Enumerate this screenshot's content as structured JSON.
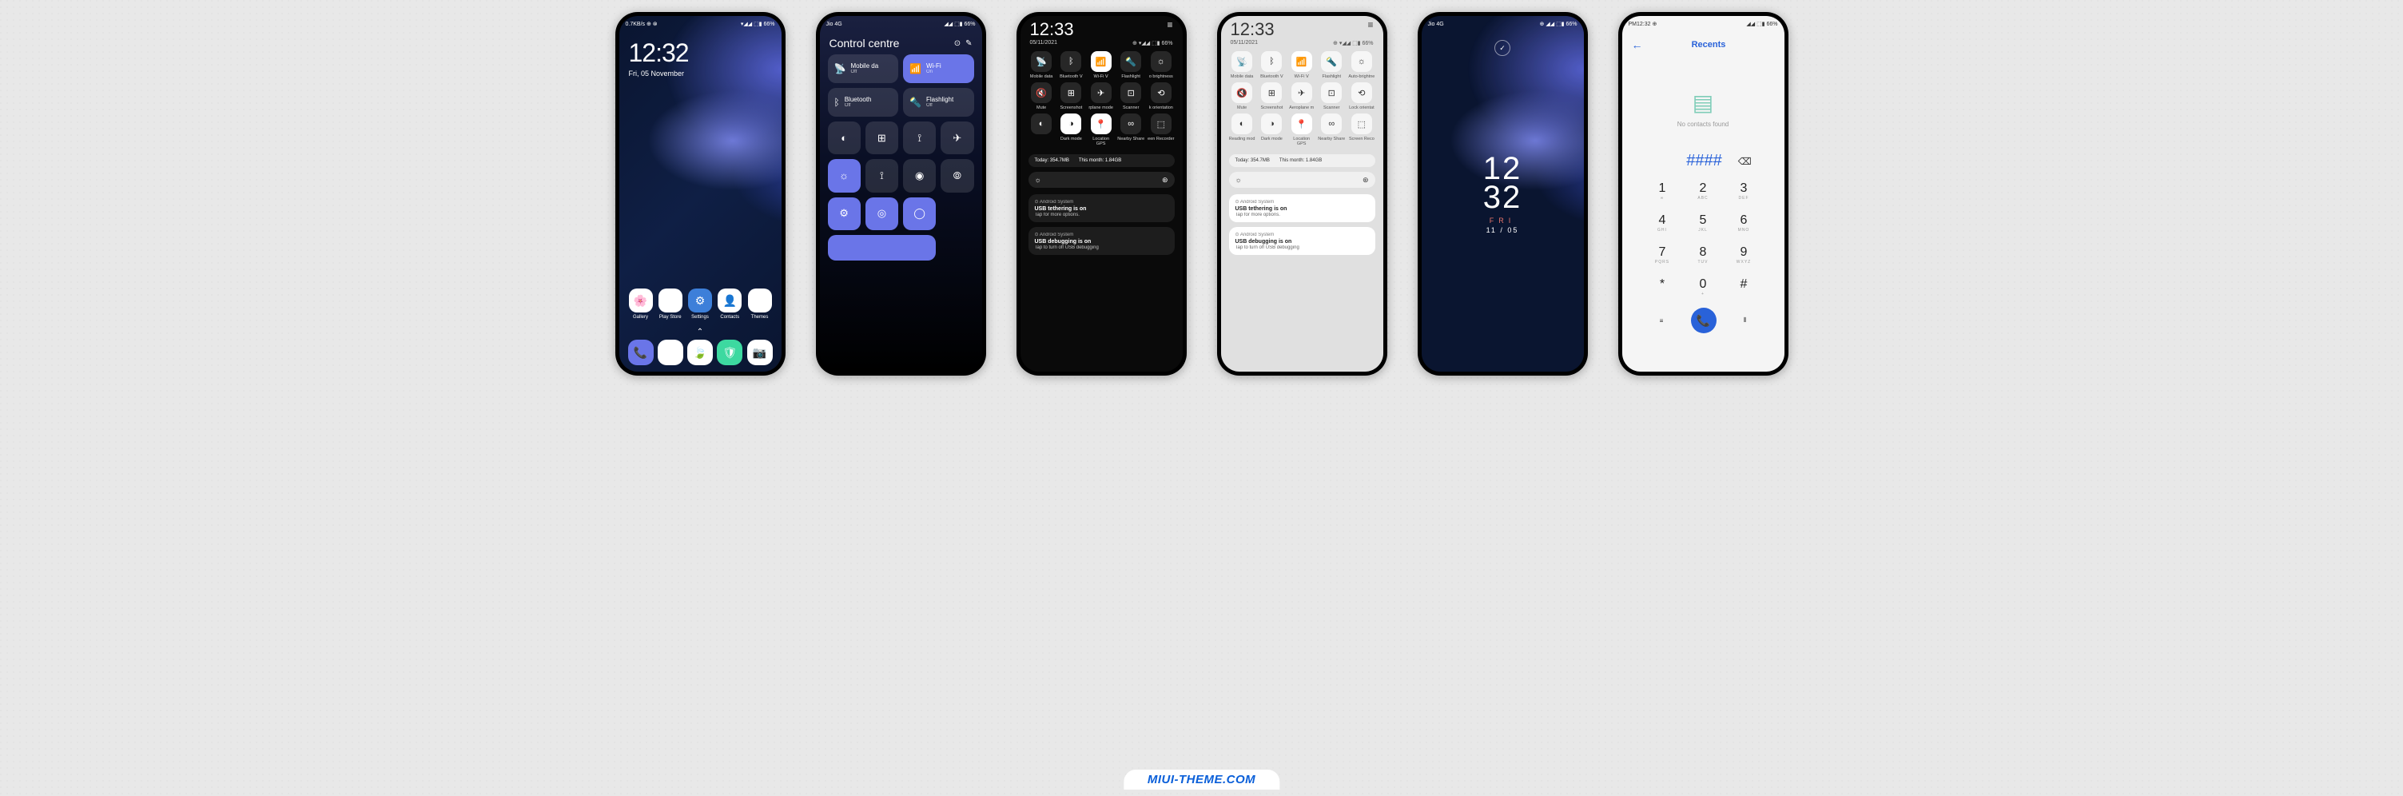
{
  "footer": "MIUI-THEME.COM",
  "p1": {
    "status_left": "0.7KB/s ⊕ ⊗",
    "status_right": "▾◢◢ ⬚▮ 66%",
    "time": "12:32",
    "date": "Fri, 05 November",
    "apps": [
      {
        "label": "Gallery",
        "color": "#fff",
        "icon": "🌸"
      },
      {
        "label": "Play Store",
        "color": "#fff",
        "icon": "▶"
      },
      {
        "label": "Settings",
        "color": "#3d7fd9",
        "icon": "⚙"
      },
      {
        "label": "Contacts",
        "color": "#fff",
        "icon": "👤"
      },
      {
        "label": "Themes",
        "color": "#fff",
        "icon": "✎"
      }
    ],
    "dock": [
      {
        "color": "#6a75e8",
        "icon": "📞"
      },
      {
        "color": "#fff",
        "icon": "▯"
      },
      {
        "color": "#fff",
        "icon": "🍃"
      },
      {
        "color": "#3dd9a0",
        "icon": "🛡"
      },
      {
        "color": "#fff",
        "icon": "📷"
      }
    ]
  },
  "p2": {
    "status_left": "Jio 4G",
    "status_right": "◢◢ ⬚▮ 66%",
    "title": "Control centre",
    "tiles": [
      {
        "icon": "📡",
        "label": "Mobile da",
        "sub": "Off",
        "on": false
      },
      {
        "icon": "📶",
        "label": "Wi-Fi",
        "sub": "On",
        "on": true
      },
      {
        "icon": "ᛒ",
        "label": "Bluetooth",
        "sub": "Off",
        "on": false
      },
      {
        "icon": "🔦",
        "label": "Flashlight",
        "sub": "Off",
        "on": false
      }
    ],
    "sq": [
      "◐",
      "⊞",
      "⟟",
      "✈",
      "☼",
      "⟟",
      "◉",
      "⦾",
      "⚙",
      "◎",
      "◯"
    ],
    "on_idx": [
      4,
      8,
      9,
      10,
      11
    ]
  },
  "p3": {
    "time": "12:33",
    "date": "05/11/2021",
    "status_right": "⊕ ▾◢◢ ⬚▮ 66%",
    "toggles": [
      {
        "label": "Mobile data",
        "icon": "📡"
      },
      {
        "label": "Bluetooth ᐯ",
        "icon": "ᛒ"
      },
      {
        "label": "Wi-Fi ᐯ",
        "icon": "📶",
        "act": true
      },
      {
        "label": "Flashlight",
        "icon": "🔦"
      },
      {
        "label": "o brightness",
        "icon": "☼"
      },
      {
        "label": "Mute",
        "icon": "🔇"
      },
      {
        "label": "Screenshot",
        "icon": "⊞"
      },
      {
        "label": "rplane mode",
        "icon": "✈"
      },
      {
        "label": "Scanner",
        "icon": "⊡"
      },
      {
        "label": "k orientation",
        "icon": "⟲"
      },
      {
        "label": "",
        "icon": "◐"
      },
      {
        "label": "Dark mode",
        "icon": "◑",
        "act": true
      },
      {
        "label": "Location",
        "icon": "📍",
        "act": true,
        "sub": "GPS"
      },
      {
        "label": "Nearby Share",
        "icon": "∞"
      },
      {
        "label": "een Recorder",
        "icon": "⬚"
      }
    ],
    "data_today_label": "Today: ",
    "data_today": "354.7MB",
    "data_month_label": "This month: ",
    "data_month": "1.84GB",
    "notifs": [
      {
        "src": "⊙ Android System",
        "title": "USB tethering is on",
        "sub": "Tap for more options."
      },
      {
        "src": "⊙ Android System",
        "title": "USB debugging is on",
        "sub": "Tap to turn off USB debugging"
      }
    ]
  },
  "p4": {
    "time": "12:33",
    "date": "05/11/2021",
    "status_right": "⊕ ▾◢◢ ⬚▮ 66%",
    "toggles": [
      {
        "label": "Mobile data",
        "icon": "📡"
      },
      {
        "label": "Bluetooth ᐯ",
        "icon": "ᛒ"
      },
      {
        "label": "Wi-Fi ᐯ",
        "icon": "📶",
        "act": true
      },
      {
        "label": "Flashlight",
        "icon": "🔦"
      },
      {
        "label": "Auto-brightne",
        "icon": "☼"
      },
      {
        "label": "Mute",
        "icon": "🔇"
      },
      {
        "label": "Screenshot",
        "icon": "⊞"
      },
      {
        "label": "Aeroplane m",
        "icon": "✈"
      },
      {
        "label": "Scanner",
        "icon": "⊡"
      },
      {
        "label": "Lock orientat",
        "icon": "⟲"
      },
      {
        "label": "Reading mod",
        "icon": "◐"
      },
      {
        "label": "Dark mode",
        "icon": "◑"
      },
      {
        "label": "Location",
        "icon": "📍",
        "act": true,
        "sub": "GPS"
      },
      {
        "label": "Nearby Share",
        "icon": "∞"
      },
      {
        "label": "Screen Reco",
        "icon": "⬚"
      }
    ],
    "data_today_label": "Today: ",
    "data_today": "354.7MB",
    "data_month_label": "This month: ",
    "data_month": "1.84GB",
    "notifs": [
      {
        "src": "⊙ Android System",
        "title": "USB tethering is on",
        "sub": "Tap for more options."
      },
      {
        "src": "⊙ Android System",
        "title": "USB debugging is on",
        "sub": "Tap to turn off USB debugging"
      }
    ]
  },
  "p5": {
    "status_left": "Jio 4G",
    "status_right": "⊕ ◢◢ ⬚▮ 66%",
    "h1": "12",
    "h2": "32",
    "day": "FRI",
    "date": "11 / 05"
  },
  "p6": {
    "status_left": "PM12:32 ⊕",
    "status_right": "◢◢ ⬚▮ 66%",
    "title": "Recents",
    "empty": "No contacts found",
    "display": "####",
    "keys": [
      {
        "n": "1",
        "l": "∞"
      },
      {
        "n": "2",
        "l": "ABC"
      },
      {
        "n": "3",
        "l": "DEF"
      },
      {
        "n": "4",
        "l": "GHI"
      },
      {
        "n": "5",
        "l": "JKL"
      },
      {
        "n": "6",
        "l": "MNO"
      },
      {
        "n": "7",
        "l": "PQRS"
      },
      {
        "n": "8",
        "l": "TUV"
      },
      {
        "n": "9",
        "l": "WXYZ"
      },
      {
        "n": "*",
        "l": ""
      },
      {
        "n": "0",
        "l": "+"
      },
      {
        "n": "#",
        "l": ""
      }
    ]
  }
}
